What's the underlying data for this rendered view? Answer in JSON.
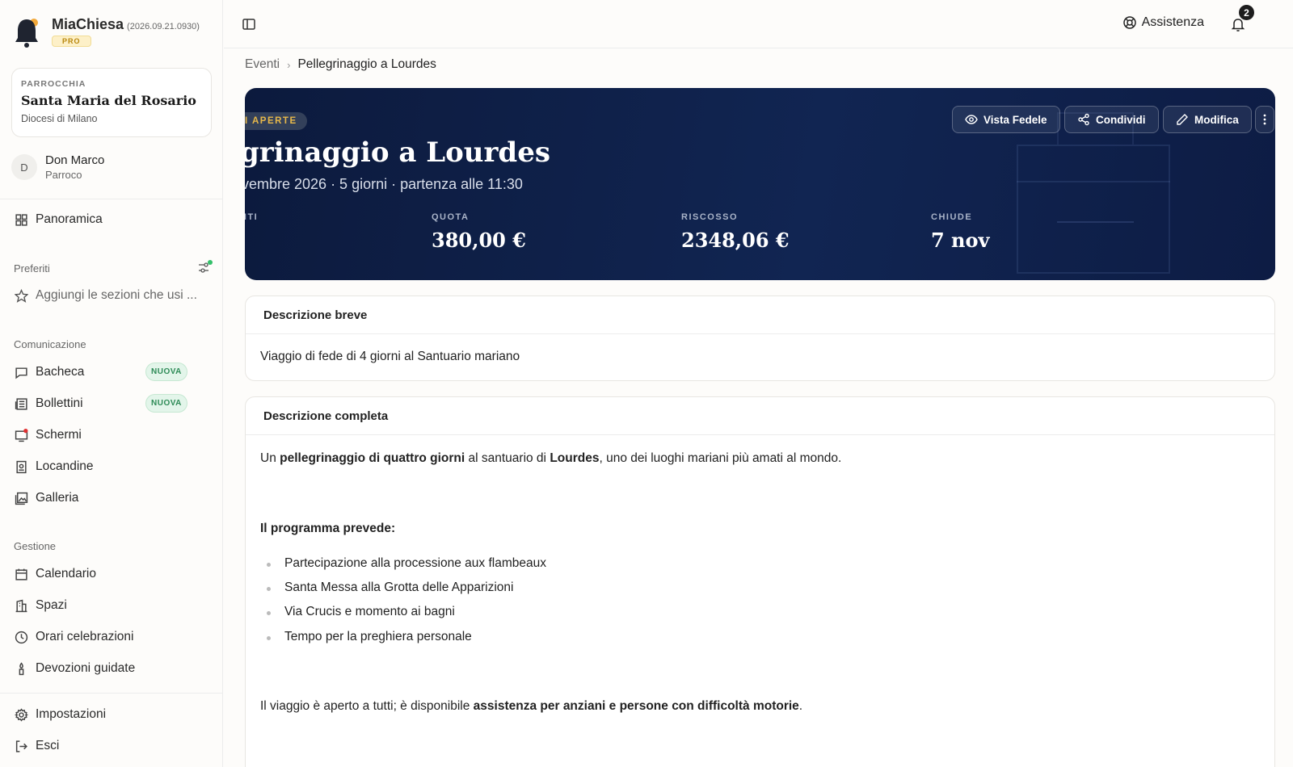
{
  "app": {
    "name": "MiaChiesa",
    "version": "(2026.09.21.0930)",
    "plan": "PRO"
  },
  "parish": {
    "label": "PARROCCHIA",
    "name": "Santa Maria del Rosario",
    "diocese": "Diocesi di Milano"
  },
  "user": {
    "initial": "D",
    "name": "Don Marco",
    "role": "Parroco"
  },
  "sidebar": {
    "overview": "Panoramica",
    "favorites_title": "Preferiti",
    "favorites_hint": "Aggiungi le sezioni che usi ...",
    "communication_title": "Comunicazione",
    "communication": [
      {
        "label": "Bacheca",
        "badge": "NUOVA"
      },
      {
        "label": "Bollettini",
        "badge": "NUOVA"
      },
      {
        "label": "Schermi"
      },
      {
        "label": "Locandine"
      },
      {
        "label": "Galleria"
      }
    ],
    "management_title": "Gestione",
    "management": [
      {
        "label": "Calendario"
      },
      {
        "label": "Spazi"
      },
      {
        "label": "Orari celebrazioni"
      },
      {
        "label": "Devozioni guidate"
      }
    ],
    "settings": "Impostazioni",
    "logout": "Esci"
  },
  "topbar": {
    "help": "Assistenza",
    "notifications": "2"
  },
  "breadcrumb": {
    "parent": "Eventi",
    "current": "Pellegrinaggio a Lourdes"
  },
  "hero": {
    "status": "I APERTE",
    "title": "grinaggio a Lourdes",
    "subtitle": "vembre 2026 · 5 giorni · partenza alle 11:30",
    "stats": [
      {
        "label": "NTI",
        "value": ""
      },
      {
        "label": "QUOTA",
        "value": "380,00 €"
      },
      {
        "label": "RISCOSSO",
        "value": "2348,06 €"
      },
      {
        "label": "CHIUDE",
        "value": "7 nov"
      }
    ],
    "buttons": {
      "preview": "Vista Fedele",
      "share": "Condividi",
      "edit": "Modifica"
    }
  },
  "short_desc": {
    "title": "Descrizione breve",
    "text": "Viaggio di fede di 4 giorni al Santuario mariano"
  },
  "full_desc": {
    "title": "Descrizione completa",
    "intro_pre": "Un ",
    "intro_b1": "pellegrinaggio di quattro giorni",
    "intro_mid": " al santuario di ",
    "intro_b2": "Lourdes",
    "intro_post": ", uno dei luoghi mariani più amati al mondo.",
    "program_title": "Il programma prevede:",
    "program": [
      "Partecipazione alla processione aux flambeaux",
      "Santa Messa alla Grotta delle Apparizioni",
      "Via Crucis e momento ai bagni",
      "Tempo per la preghiera personale"
    ],
    "outro_pre": "Il viaggio è aperto a tutti; è disponibile ",
    "outro_b": "assistenza per anziani e persone con difficoltà motorie",
    "outro_post": "."
  }
}
